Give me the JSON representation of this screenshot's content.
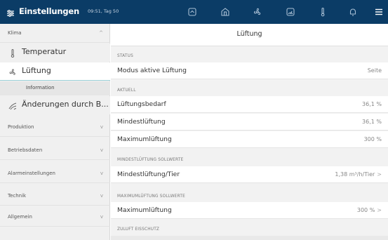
{
  "topbar": {
    "title": "Einstellungen",
    "meta": "09:51, Tag 50",
    "menu_icon": "sliders-icon",
    "nav_icons": [
      "home-icon",
      "house-icon",
      "fan-icon",
      "gauge-icon",
      "thermometer-icon",
      "bell-icon",
      "menu-icon"
    ]
  },
  "sidebar": {
    "groups": [
      {
        "label": "Klima",
        "chev": "^"
      },
      {
        "label": "Produktion",
        "chev": "v"
      },
      {
        "label": "Betriebsdaten",
        "chev": "v"
      },
      {
        "label": "Alarmeinstellungen",
        "chev": "v"
      },
      {
        "label": "Technik",
        "chev": "v"
      },
      {
        "label": "Allgemein",
        "chev": "v"
      }
    ],
    "items": [
      {
        "label": "Temperatur",
        "icon": "thermometer-icon"
      },
      {
        "label": "Lüftung",
        "icon": "fan-icon"
      },
      {
        "label": "Änderungen durch B...",
        "icon": "wind-icon"
      }
    ],
    "sub": {
      "label": "Information"
    }
  },
  "main": {
    "title": "Lüftung",
    "sections": [
      {
        "label": "STATUS"
      },
      {
        "label": "AKTUELL"
      },
      {
        "label": "MINDESTLÜFTUNG SOLLWERTE"
      },
      {
        "label": "MAXIMUMLÜFTUNG SOLLWERTE"
      },
      {
        "label": "ZULUFT EISSCHUTZ"
      }
    ],
    "rows": [
      {
        "key": "Modus aktive Lüftung",
        "value": "Seite"
      },
      {
        "key": "Lüftungsbedarf",
        "value": "36,1 %"
      },
      {
        "key": "Mindestlüftung",
        "value": "36,1 %"
      },
      {
        "key": "Maximumlüftung",
        "value": "300 %"
      },
      {
        "key": "Mindestlüftung/Tier",
        "value": "1,38 m³/h/Tier",
        "chev": ">"
      },
      {
        "key": "Maximumlüftung",
        "value": "300 %",
        "chev": ">"
      }
    ]
  },
  "colors": {
    "topbar": "#0b3c66",
    "active_border": "#9ad0d8"
  }
}
